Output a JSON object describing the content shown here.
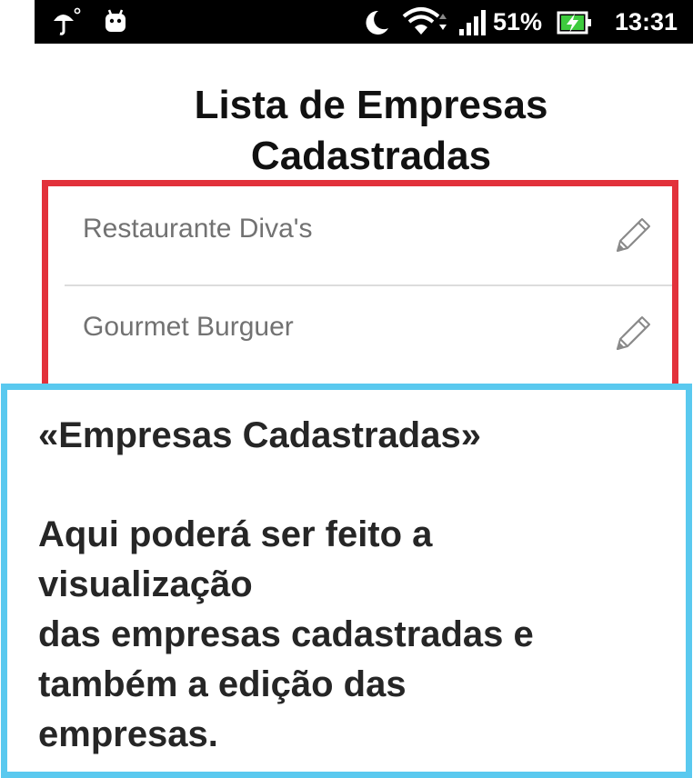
{
  "status_bar": {
    "battery_percent": "51%",
    "time": "13:31",
    "icons": [
      "umbrella-icon",
      "android-icon",
      "moon-icon",
      "wifi-icon",
      "signal-icon",
      "battery-charging-icon"
    ]
  },
  "page": {
    "title_line1": "Lista de Empresas",
    "title_line2": "Cadastradas"
  },
  "companies": [
    {
      "name": "Restaurante Diva's",
      "action_icon": "pencil-icon"
    },
    {
      "name": "Gourmet Burguer",
      "action_icon": "pencil-icon"
    }
  ],
  "callout": {
    "heading": "«Empresas Cadastradas»",
    "body_lines": [
      "Aqui poderá ser feito a",
      "visualização",
      "das empresas cadastradas e",
      "também a edição das",
      "empresas."
    ]
  },
  "colors": {
    "highlight_red": "#e2313b",
    "callout_blue": "#5ac9ef",
    "status_bar_bg": "#000000",
    "battery_green": "#3ecb3e"
  }
}
